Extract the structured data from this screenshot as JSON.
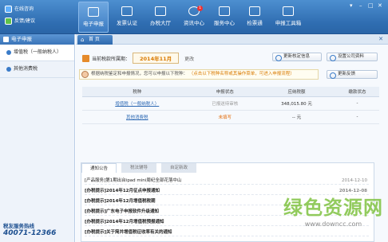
{
  "status": {
    "online_label": "在线咨询",
    "feedback_label": "反馈/建议"
  },
  "nav": [
    {
      "label": "电子申报",
      "icon": "report-icon",
      "active": true
    },
    {
      "label": "发票认证",
      "icon": "invoice-icon"
    },
    {
      "label": "办税大厅",
      "icon": "hall-icon"
    },
    {
      "label": "资讯中心",
      "icon": "news-icon",
      "badge": "1"
    },
    {
      "label": "服务中心",
      "icon": "service-icon"
    },
    {
      "label": "检票通",
      "icon": "ticket-icon"
    },
    {
      "label": "申报工具箱",
      "icon": "toolbox-icon"
    }
  ],
  "sidebar": {
    "header": "电子申报",
    "items": [
      {
        "label": "增值税（一般纳税人）"
      },
      {
        "label": "其他消费税"
      }
    ],
    "hotline_title": "税友服务热线",
    "hotline_number": "40071-12366"
  },
  "tabs": {
    "home": "首 页"
  },
  "period": {
    "label": "当前税款所属期：",
    "value": "2014年11月",
    "change": "更改"
  },
  "buttons": {
    "update_verify": "更新核定信息",
    "settings": "设置公司资料",
    "refresh": "更新反馈"
  },
  "notice": {
    "prefix": "根据纳税鉴定和申报情况，您可以申报以下税种：",
    "hint": "（点击以下税种名称或其操作菜单，可进入申报流程）"
  },
  "table": {
    "headers": [
      "税种",
      "申报状态",
      "应纳税额",
      "缴款状态"
    ],
    "rows": [
      {
        "name": "增值税（一般纳税人）",
        "status": "已报送待审核",
        "amount": "348,015.80 元",
        "pay": "-"
      },
      {
        "name": "其他消费税",
        "status": "未填写",
        "amount": "-- 元",
        "pay": "-"
      }
    ]
  },
  "notices": {
    "tabs": [
      "通知公告",
      "税法辅导",
      "自定新政"
    ],
    "items": [
      {
        "text": "[产品服务]第1期出台ipad mini周纪全部花落中山",
        "date": "2014-12-10"
      },
      {
        "text": "[办税提示]2014年12月征点申报通知",
        "date": "2014-12-08"
      },
      {
        "text": "[办税提示]2014年12月增值税税期",
        "date": ""
      },
      {
        "text": "[办税提示]广东电子申报软件升级通知",
        "date": ""
      },
      {
        "text": "[办税提示]2014年12月增值税预报通知",
        "date": ""
      },
      {
        "text": "[办税提示]关于简并增值税征收率有关的通知",
        "date": ""
      }
    ]
  },
  "watermark": {
    "line1": "绿色资源网",
    "line2": "www.downcc.com"
  },
  "colors": {
    "topbar": "#3574b9",
    "accent": "#2c68b3",
    "warning": "#e36c0a",
    "watermark": "#7fc241"
  }
}
